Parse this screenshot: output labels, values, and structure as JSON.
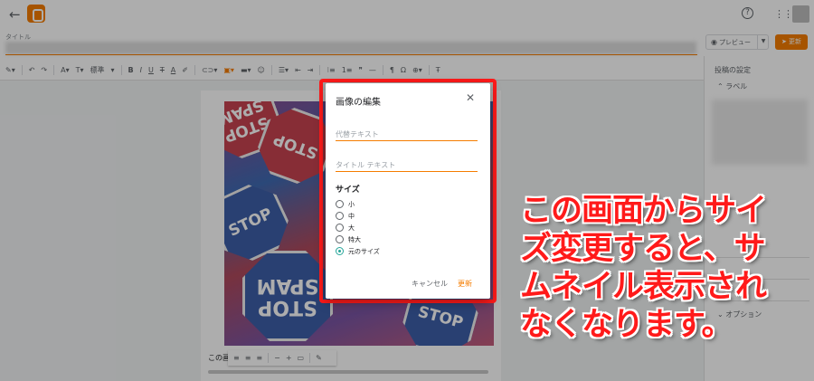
{
  "header": {
    "back_icon": "arrow-left-icon",
    "logo_icon": "blogger-logo",
    "help_icon": "help-icon",
    "apps_icon": "apps-grid-icon",
    "title_label": "タイトル",
    "preview_label": "プレビュー",
    "update_label": "更新"
  },
  "toolbar": {
    "style_label": "標準"
  },
  "sidebar": {
    "title": "投稿の設定",
    "labels_item": "ラベル",
    "options_item": "オプション"
  },
  "image": {
    "sign_texts": [
      "STOP SPAM",
      "STOP",
      "STOP",
      "STOP SPAM",
      "STOP"
    ]
  },
  "caption": "この画",
  "dialog": {
    "title": "画像の編集",
    "close_icon": "close-icon",
    "alt_text_placeholder": "代替テキスト",
    "title_text_placeholder": "タイトル テキスト",
    "size_heading": "サイズ",
    "size_options": [
      "小",
      "中",
      "大",
      "特大",
      "元のサイズ"
    ],
    "selected_size": "元のサイズ",
    "cancel_label": "キャンセル",
    "update_label": "更新"
  },
  "annotation": "この画面からサイズ変更すると、サムネイル表示されなくなります。",
  "colors": {
    "accent": "#f57c00",
    "highlight": "#ff1a1a",
    "radio_selected": "#26a69a"
  }
}
